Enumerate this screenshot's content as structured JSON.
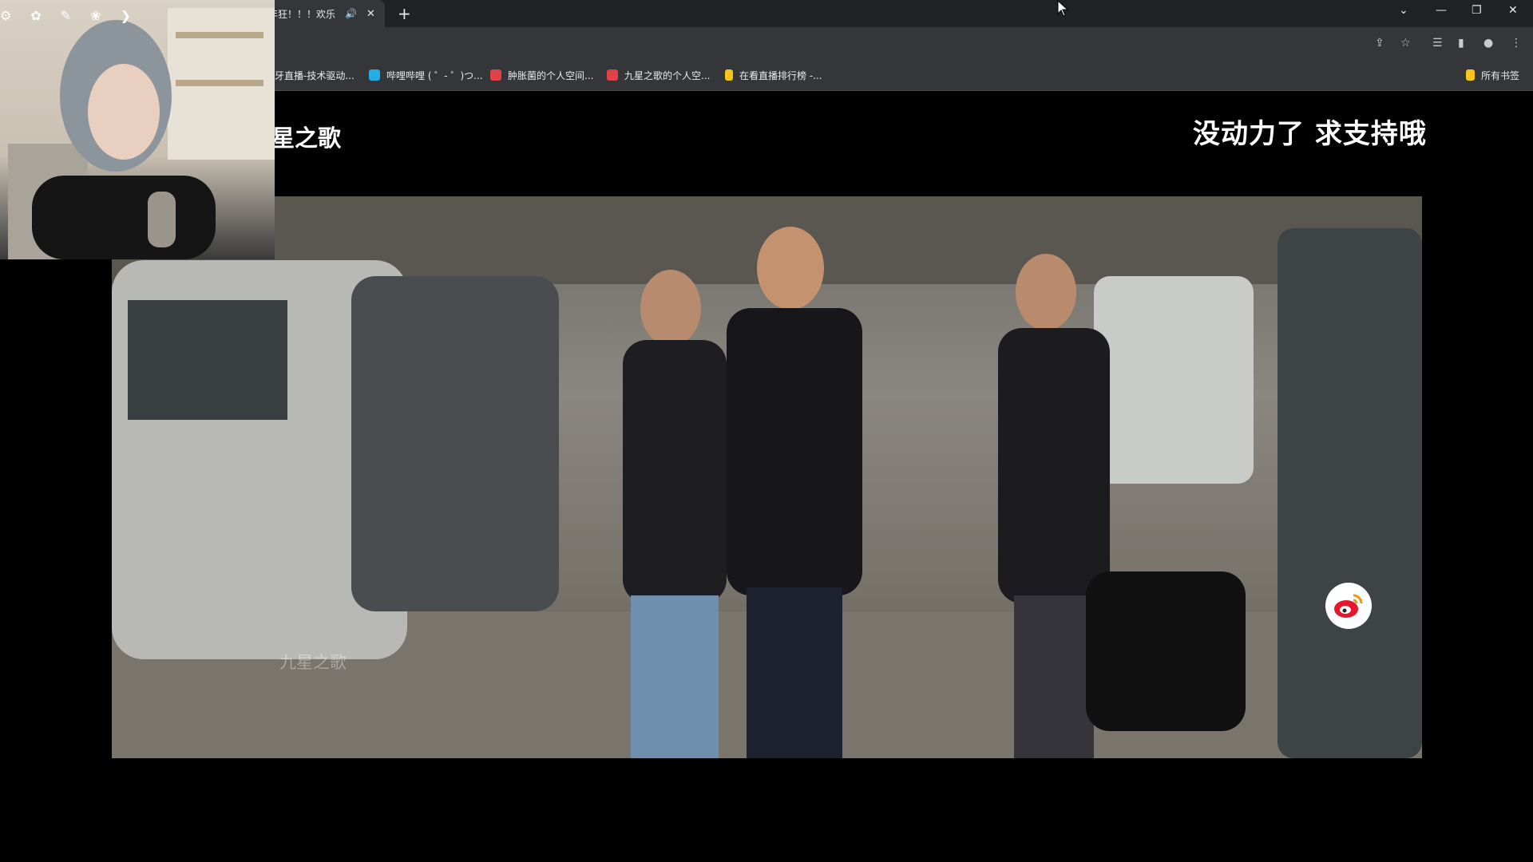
{
  "browser": {
    "tab": {
      "title": "年狂！！！欢乐",
      "audio_icon": "speaker-icon"
    },
    "window_controls": [
      "chevron-down-icon",
      "minimize-icon",
      "restore-icon",
      "close-icon"
    ],
    "toolbar_icons": [
      "share-icon",
      "star-icon",
      "playlist-icon",
      "sidepanel-icon",
      "profile-icon",
      "menu-icon"
    ],
    "bookmarks": [
      {
        "label": "牙直播-技术驱动...",
        "color": "#f5a623"
      },
      {
        "label": "哔哩哔哩 ( ゜- ゜)つ...",
        "color": "#23ade5"
      },
      {
        "label": "肿胀菌的个人空间...",
        "color": "#e0424a"
      },
      {
        "label": "九星之歌的个人空...",
        "color": "#e0424a"
      },
      {
        "label": "在看直播排行榜 -...",
        "color": "#f5c518"
      }
    ],
    "all_bookmarks": "所有书签"
  },
  "page": {
    "channel_title": "星之歌",
    "caption": "没动力了 求支持哦",
    "video_watermark": "九星之歌"
  },
  "colors": {
    "chrome_dark": "#202124",
    "chrome_toolbar": "#35363a",
    "weibo_red": "#e6162d"
  }
}
